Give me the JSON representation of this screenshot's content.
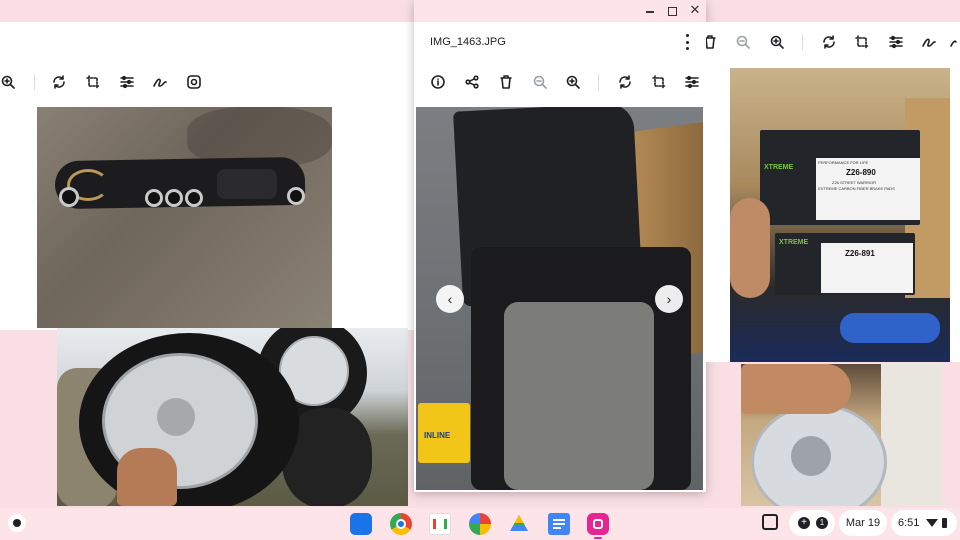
{
  "viewer": {
    "filename": "IMG_1463.JPG",
    "window_controls": [
      "minimize-icon",
      "maximize-icon",
      "close-icon"
    ],
    "toolbar_icons": [
      "info-icon",
      "share-icon",
      "delete-icon",
      "zoom-out-icon",
      "zoom-in-icon",
      "rotate-icon",
      "crop-icon",
      "adjust-icon"
    ]
  },
  "left_window": {
    "toolbar_icons": [
      "zoom-in-icon",
      "rotate-icon",
      "crop-icon",
      "adjust-icon",
      "draw-icon",
      "lens-icon"
    ]
  },
  "right_window": {
    "toolbar_icons": [
      "delete-icon",
      "zoom-out-icon",
      "zoom-in-icon",
      "rotate-icon",
      "crop-icon",
      "adjust-icon",
      "draw-icon",
      "more-icon"
    ]
  },
  "photos": {
    "brake_box_top": {
      "line1": "PERFORMANCE FOR LIFE",
      "code": "Z26-890",
      "line2": "Z26 STREET WARRIOR",
      "line3": "EXTREME CARBON FIBER BRAKE PADS",
      "brand": "XTREME"
    },
    "brake_box_bottom": {
      "code": "Z26-891",
      "brand": "XTREME"
    },
    "inline_box": "INLINE"
  },
  "shelf": {
    "apps": [
      "files-icon",
      "chrome-icon",
      "gmail-icon",
      "photos-icon",
      "drive-icon",
      "docs-icon",
      "gallery-icon"
    ],
    "notification_count": "1",
    "date": "Mar 19",
    "time": "6:51"
  },
  "colors": {
    "desktop": "#f9dfe4",
    "shelf": "#fde4e8",
    "accent": "#1a73e8"
  }
}
